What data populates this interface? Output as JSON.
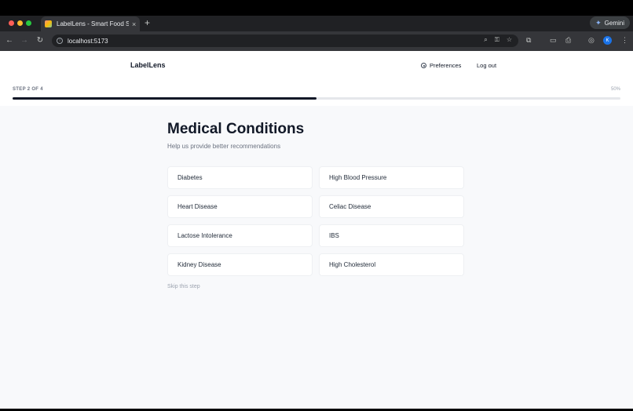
{
  "browser": {
    "tab_title": "LabelLens - Smart Food Scanner",
    "tab_close": "×",
    "new_tab": "+",
    "url": "localhost:5173",
    "gemini_label": "Gemini",
    "profile_initial": "K"
  },
  "header": {
    "logo": "LabelLens",
    "preferences": "Preferences",
    "logout": "Log out"
  },
  "progress": {
    "step_label": "STEP 2 OF 4",
    "percent_label": "50%",
    "fraction": 0.5
  },
  "main": {
    "title": "Medical Conditions",
    "subtitle": "Help us provide better recommendations",
    "options": [
      "Diabetes",
      "High Blood Pressure",
      "Heart Disease",
      "Celiac Disease",
      "Lactose Intolerance",
      "IBS",
      "Kidney Disease",
      "High Cholesterol"
    ],
    "skip": "Skip this step"
  },
  "colors": {
    "accent": "#111827",
    "page_bg": "#f8f9fb",
    "muted": "#6b7280"
  }
}
